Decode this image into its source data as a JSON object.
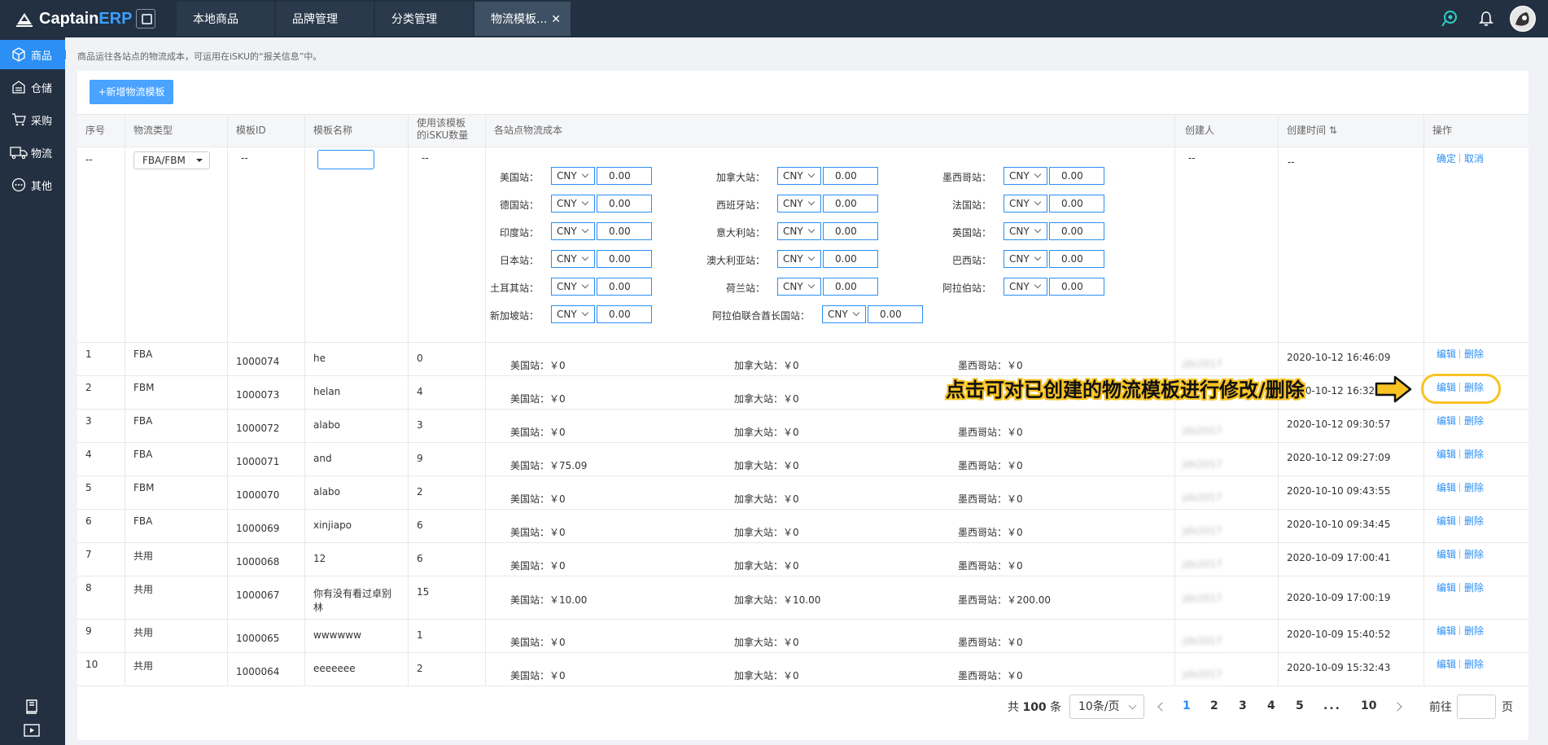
{
  "brand": {
    "name_part1": "Captain",
    "name_part2": "ERP"
  },
  "tabs": [
    {
      "label": "本地商品"
    },
    {
      "label": "品牌管理"
    },
    {
      "label": "分类管理"
    },
    {
      "label": "物流模板...",
      "close": "✕"
    }
  ],
  "sidebar": {
    "items": [
      {
        "label": "商品"
      },
      {
        "label": "仓储"
      },
      {
        "label": "采购"
      },
      {
        "label": "物流"
      },
      {
        "label": "其他"
      }
    ]
  },
  "notice": "商品运往各站点的物流成本，可运用在iSKU的“报关信息”中。",
  "add_button": "+新增物流模板",
  "table": {
    "headers": {
      "index": "序号",
      "type": "物流类型",
      "id": "模板ID",
      "name": "模板名称",
      "count_line1": "使用该模板",
      "count_line2": "的iSKU数量",
      "cost": "各站点物流成本",
      "creator": "创建人",
      "created": "创建时间",
      "sort_icon": "⇅",
      "ops": "操作"
    },
    "edit_row": {
      "index": "--",
      "type": "FBA/FBM",
      "id": "--",
      "count": "--",
      "creator": "--",
      "created": "--",
      "confirm": "确定",
      "cancel": "取消",
      "currency": "CNY",
      "amount": "0.00",
      "sites": [
        [
          "美国站：",
          "加拿大站：",
          "墨西哥站："
        ],
        [
          "德国站：",
          "西班牙站：",
          "法国站："
        ],
        [
          "印度站：",
          "意大利站：",
          "英国站："
        ],
        [
          "日本站：",
          "澳大利亚站：",
          "巴西站："
        ],
        [
          "土耳其站：",
          "荷兰站：",
          "阿拉伯站："
        ],
        [
          "新加坡站：",
          "阿拉伯联合酋长国站："
        ]
      ]
    },
    "rows": [
      {
        "index": "1",
        "type": "FBA",
        "id": "1000074",
        "name": "he",
        "count": "0",
        "us": "美国站：￥0",
        "ca": "加拿大站：￥0",
        "mx": "墨西哥站：￥0",
        "creator": "jdx2017",
        "created": "2020-10-12 16:46:09"
      },
      {
        "index": "2",
        "type": "FBM",
        "id": "1000073",
        "name": "helan",
        "count": "4",
        "us": "美国站：￥0",
        "ca": "加拿大站：￥0",
        "mx": "",
        "creator": "",
        "created": "2020-10-12 16:32:"
      },
      {
        "index": "3",
        "type": "FBA",
        "id": "1000072",
        "name": "alabo",
        "count": "3",
        "us": "美国站：￥0",
        "ca": "加拿大站：￥0",
        "mx": "墨西哥站：￥0",
        "creator": "jdx2017",
        "created": "2020-10-12 09:30:57"
      },
      {
        "index": "4",
        "type": "FBA",
        "id": "1000071",
        "name": "and",
        "count": "9",
        "us": "美国站：￥75.09",
        "ca": "加拿大站：￥0",
        "mx": "墨西哥站：￥0",
        "creator": "jdx2017",
        "created": "2020-10-12 09:27:09"
      },
      {
        "index": "5",
        "type": "FBM",
        "id": "1000070",
        "name": "alabo",
        "count": "2",
        "us": "美国站：￥0",
        "ca": "加拿大站：￥0",
        "mx": "墨西哥站：￥0",
        "creator": "jdx2017",
        "created": "2020-10-10 09:43:55"
      },
      {
        "index": "6",
        "type": "FBA",
        "id": "1000069",
        "name": "xinjiapo",
        "count": "6",
        "us": "美国站：￥0",
        "ca": "加拿大站：￥0",
        "mx": "墨西哥站：￥0",
        "creator": "jdx2017",
        "created": "2020-10-10 09:34:45"
      },
      {
        "index": "7",
        "type": "共用",
        "id": "1000068",
        "name": "12",
        "count": "6",
        "us": "美国站：￥0",
        "ca": "加拿大站：￥0",
        "mx": "墨西哥站：￥0",
        "creator": "jdx2017",
        "created": "2020-10-09 17:00:41"
      },
      {
        "index": "8",
        "type": "共用",
        "id": "1000067",
        "name": "你有没有看过卓别",
        "name2": "林",
        "count": "15",
        "us": "美国站：￥10.00",
        "ca": "加拿大站：￥10.00",
        "mx": "墨西哥站：￥200.00",
        "creator": "jdx2017",
        "created": "2020-10-09 17:00:19"
      },
      {
        "index": "9",
        "type": "共用",
        "id": "1000065",
        "name": "wwwwww",
        "count": "1",
        "us": "美国站：￥0",
        "ca": "加拿大站：￥0",
        "mx": "墨西哥站：￥0",
        "creator": "jdx2017",
        "created": "2020-10-09 15:40:52"
      },
      {
        "index": "10",
        "type": "共用",
        "id": "1000064",
        "name": "eeeeeee",
        "count": "2",
        "us": "美国站：￥0",
        "ca": "加拿大站：￥0",
        "mx": "墨西哥站：￥0",
        "creator": "jdx2017",
        "created": "2020-10-09 15:32:43"
      }
    ],
    "edit_label": "编辑",
    "delete_label": "删除"
  },
  "annotation": "点击可对已创建的物流模板进行修改/删除",
  "pagination": {
    "total_prefix": "共",
    "total": "100",
    "total_suffix": "条",
    "page_size": "10条/页",
    "pages": [
      "1",
      "2",
      "3",
      "4",
      "5"
    ],
    "ellipsis": "...",
    "last": "10",
    "jump_prefix": "前往",
    "jump_suffix": "页"
  },
  "colors": {
    "accent": "#2b8ff5",
    "topbar": "#223041",
    "highlight": "#f9c323"
  }
}
